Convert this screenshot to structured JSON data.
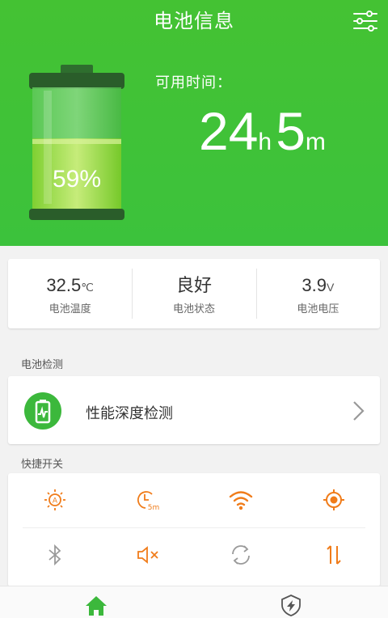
{
  "header": {
    "title": "电池信息",
    "available_label": "可用时间：",
    "time": {
      "hours": "24",
      "hours_unit": "h",
      "minutes": "5",
      "minutes_unit": "m"
    },
    "battery_percent": "59%",
    "battery_level": 0.59,
    "settings_icon": "settings-sliders-icon"
  },
  "stats": [
    {
      "value": "32.5",
      "unit": "℃",
      "label": "电池温度"
    },
    {
      "value": "良好",
      "unit": "",
      "label": "电池状态"
    },
    {
      "value": "3.9",
      "unit": "V",
      "label": "电池电压"
    }
  ],
  "sections": {
    "detection_title": "电池检测",
    "switches_title": "快捷开关"
  },
  "detection": {
    "label": "性能深度检测",
    "icon": "battery-check-icon"
  },
  "switches": [
    {
      "name": "auto-brightness",
      "icon": "auto-brightness-icon",
      "color": "#f07c1a"
    },
    {
      "name": "screen-timeout",
      "icon": "timer-5m-icon",
      "label": "5m",
      "color": "#f07c1a"
    },
    {
      "name": "wifi",
      "icon": "wifi-icon",
      "color": "#f07c1a"
    },
    {
      "name": "gps",
      "icon": "gps-icon",
      "color": "#f07c1a"
    },
    {
      "name": "bluetooth",
      "icon": "bluetooth-icon",
      "color": "#9a9a9a"
    },
    {
      "name": "sound",
      "icon": "mute-icon",
      "color": "#f07c1a"
    },
    {
      "name": "auto-rotate",
      "icon": "rotate-icon",
      "color": "#9a9a9a"
    },
    {
      "name": "mobile-data",
      "icon": "data-arrows-icon",
      "color": "#f07c1a"
    }
  ],
  "nav": {
    "items": [
      {
        "icon": "home-icon",
        "active": true,
        "color": "#3cb83c"
      },
      {
        "icon": "shield-bolt-icon",
        "active": false,
        "color": "#555555"
      }
    ]
  },
  "colors": {
    "brand_green": "#44c233",
    "accent_orange": "#f07c1a",
    "inactive_gray": "#9a9a9a"
  }
}
